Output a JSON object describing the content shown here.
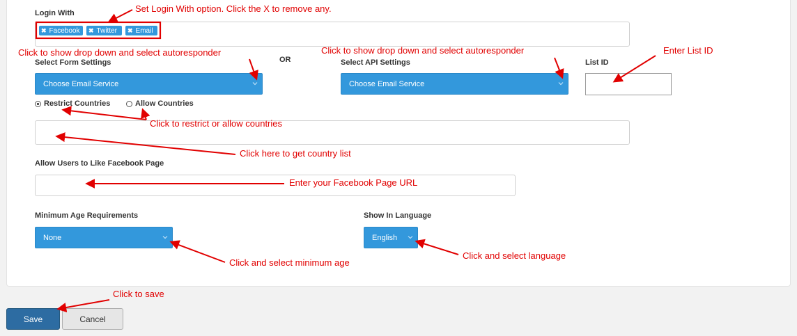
{
  "form": {
    "login_with": {
      "label": "Login With",
      "tags": [
        {
          "label": "Facebook",
          "remove_icon": "✖"
        },
        {
          "label": "Twitter",
          "remove_icon": "✖"
        },
        {
          "label": "Email",
          "remove_icon": "✖"
        }
      ]
    },
    "form_settings": {
      "label": "Select Form Settings",
      "value": "Choose Email Service"
    },
    "or_text": "OR",
    "api_settings": {
      "label": "Select API Settings",
      "value": "Choose Email Service"
    },
    "list_id": {
      "label": "List ID",
      "value": ""
    },
    "countries": {
      "options": [
        {
          "label": "Restrict Countries",
          "selected": true
        },
        {
          "label": "Allow Countries",
          "selected": false
        }
      ],
      "value": ""
    },
    "facebook_page": {
      "label": "Allow Users to Like Facebook Page",
      "value": ""
    },
    "min_age": {
      "label": "Minimum Age Requirements",
      "value": "None"
    },
    "language": {
      "label": "Show In Language",
      "value": "English"
    }
  },
  "buttons": {
    "save": "Save",
    "cancel": "Cancel"
  },
  "annotations": {
    "login_with": "Set Login With option. Click the X to remove any.",
    "form_settings": "Click to show drop down and select autoresponder",
    "api_settings": "Click to show drop down and select autoresponder",
    "list_id": "Enter List ID",
    "countries": "Click to restrict or allow countries",
    "country_list": "Click here to get country list",
    "facebook_page": "Enter your Facebook Page URL",
    "min_age": "Click and select minimum age",
    "language": "Click and select language",
    "save": "Click to save"
  },
  "colors": {
    "select_bg": "#3398dc",
    "annotation": "#e10000",
    "save_bg": "#2d6ca2"
  },
  "icons": {
    "tag_remove": "close-icon",
    "dropdown": "chevron-down-icon"
  }
}
